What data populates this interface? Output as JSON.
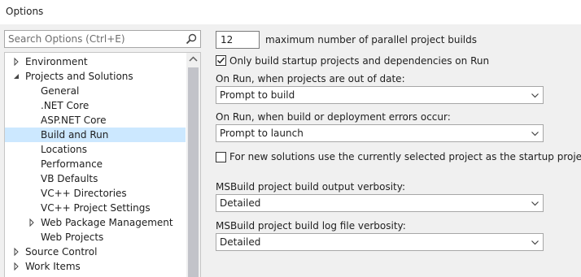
{
  "window": {
    "title": "Options"
  },
  "search": {
    "placeholder": "Search Options (Ctrl+E)"
  },
  "tree": {
    "items": [
      {
        "label": "Environment",
        "arrow": "right"
      },
      {
        "label": "Projects and Solutions",
        "arrow": "down"
      },
      {
        "label": "General",
        "arrow": ""
      },
      {
        "label": ".NET Core",
        "arrow": ""
      },
      {
        "label": "ASP.NET Core",
        "arrow": ""
      },
      {
        "label": "Build and Run",
        "arrow": "",
        "selected": true
      },
      {
        "label": "Locations",
        "arrow": ""
      },
      {
        "label": "Performance",
        "arrow": ""
      },
      {
        "label": "VB Defaults",
        "arrow": ""
      },
      {
        "label": "VC++ Directories",
        "arrow": ""
      },
      {
        "label": "VC++ Project Settings",
        "arrow": ""
      },
      {
        "label": "Web Package Management",
        "arrow": "right"
      },
      {
        "label": "Web Projects",
        "arrow": ""
      },
      {
        "label": "Source Control",
        "arrow": "right"
      },
      {
        "label": "Work Items",
        "arrow": "right"
      }
    ]
  },
  "settings": {
    "parallel_builds_value": "12",
    "parallel_builds_label": "maximum number of parallel project builds",
    "startup_only_label": "Only build startup projects and dependencies on Run",
    "startup_only_checked": true,
    "out_of_date_label": "On Run, when projects are out of date:",
    "out_of_date_value": "Prompt to build",
    "errors_label": "On Run, when build or deployment errors occur:",
    "errors_value": "Prompt to launch",
    "new_solutions_label": "For new solutions use the currently selected project as the startup project",
    "new_solutions_checked": false,
    "output_verbosity_label": "MSBuild project build output verbosity:",
    "output_verbosity_value": "Detailed",
    "log_verbosity_label": "MSBuild project build log file verbosity:",
    "log_verbosity_value": "Detailed"
  }
}
